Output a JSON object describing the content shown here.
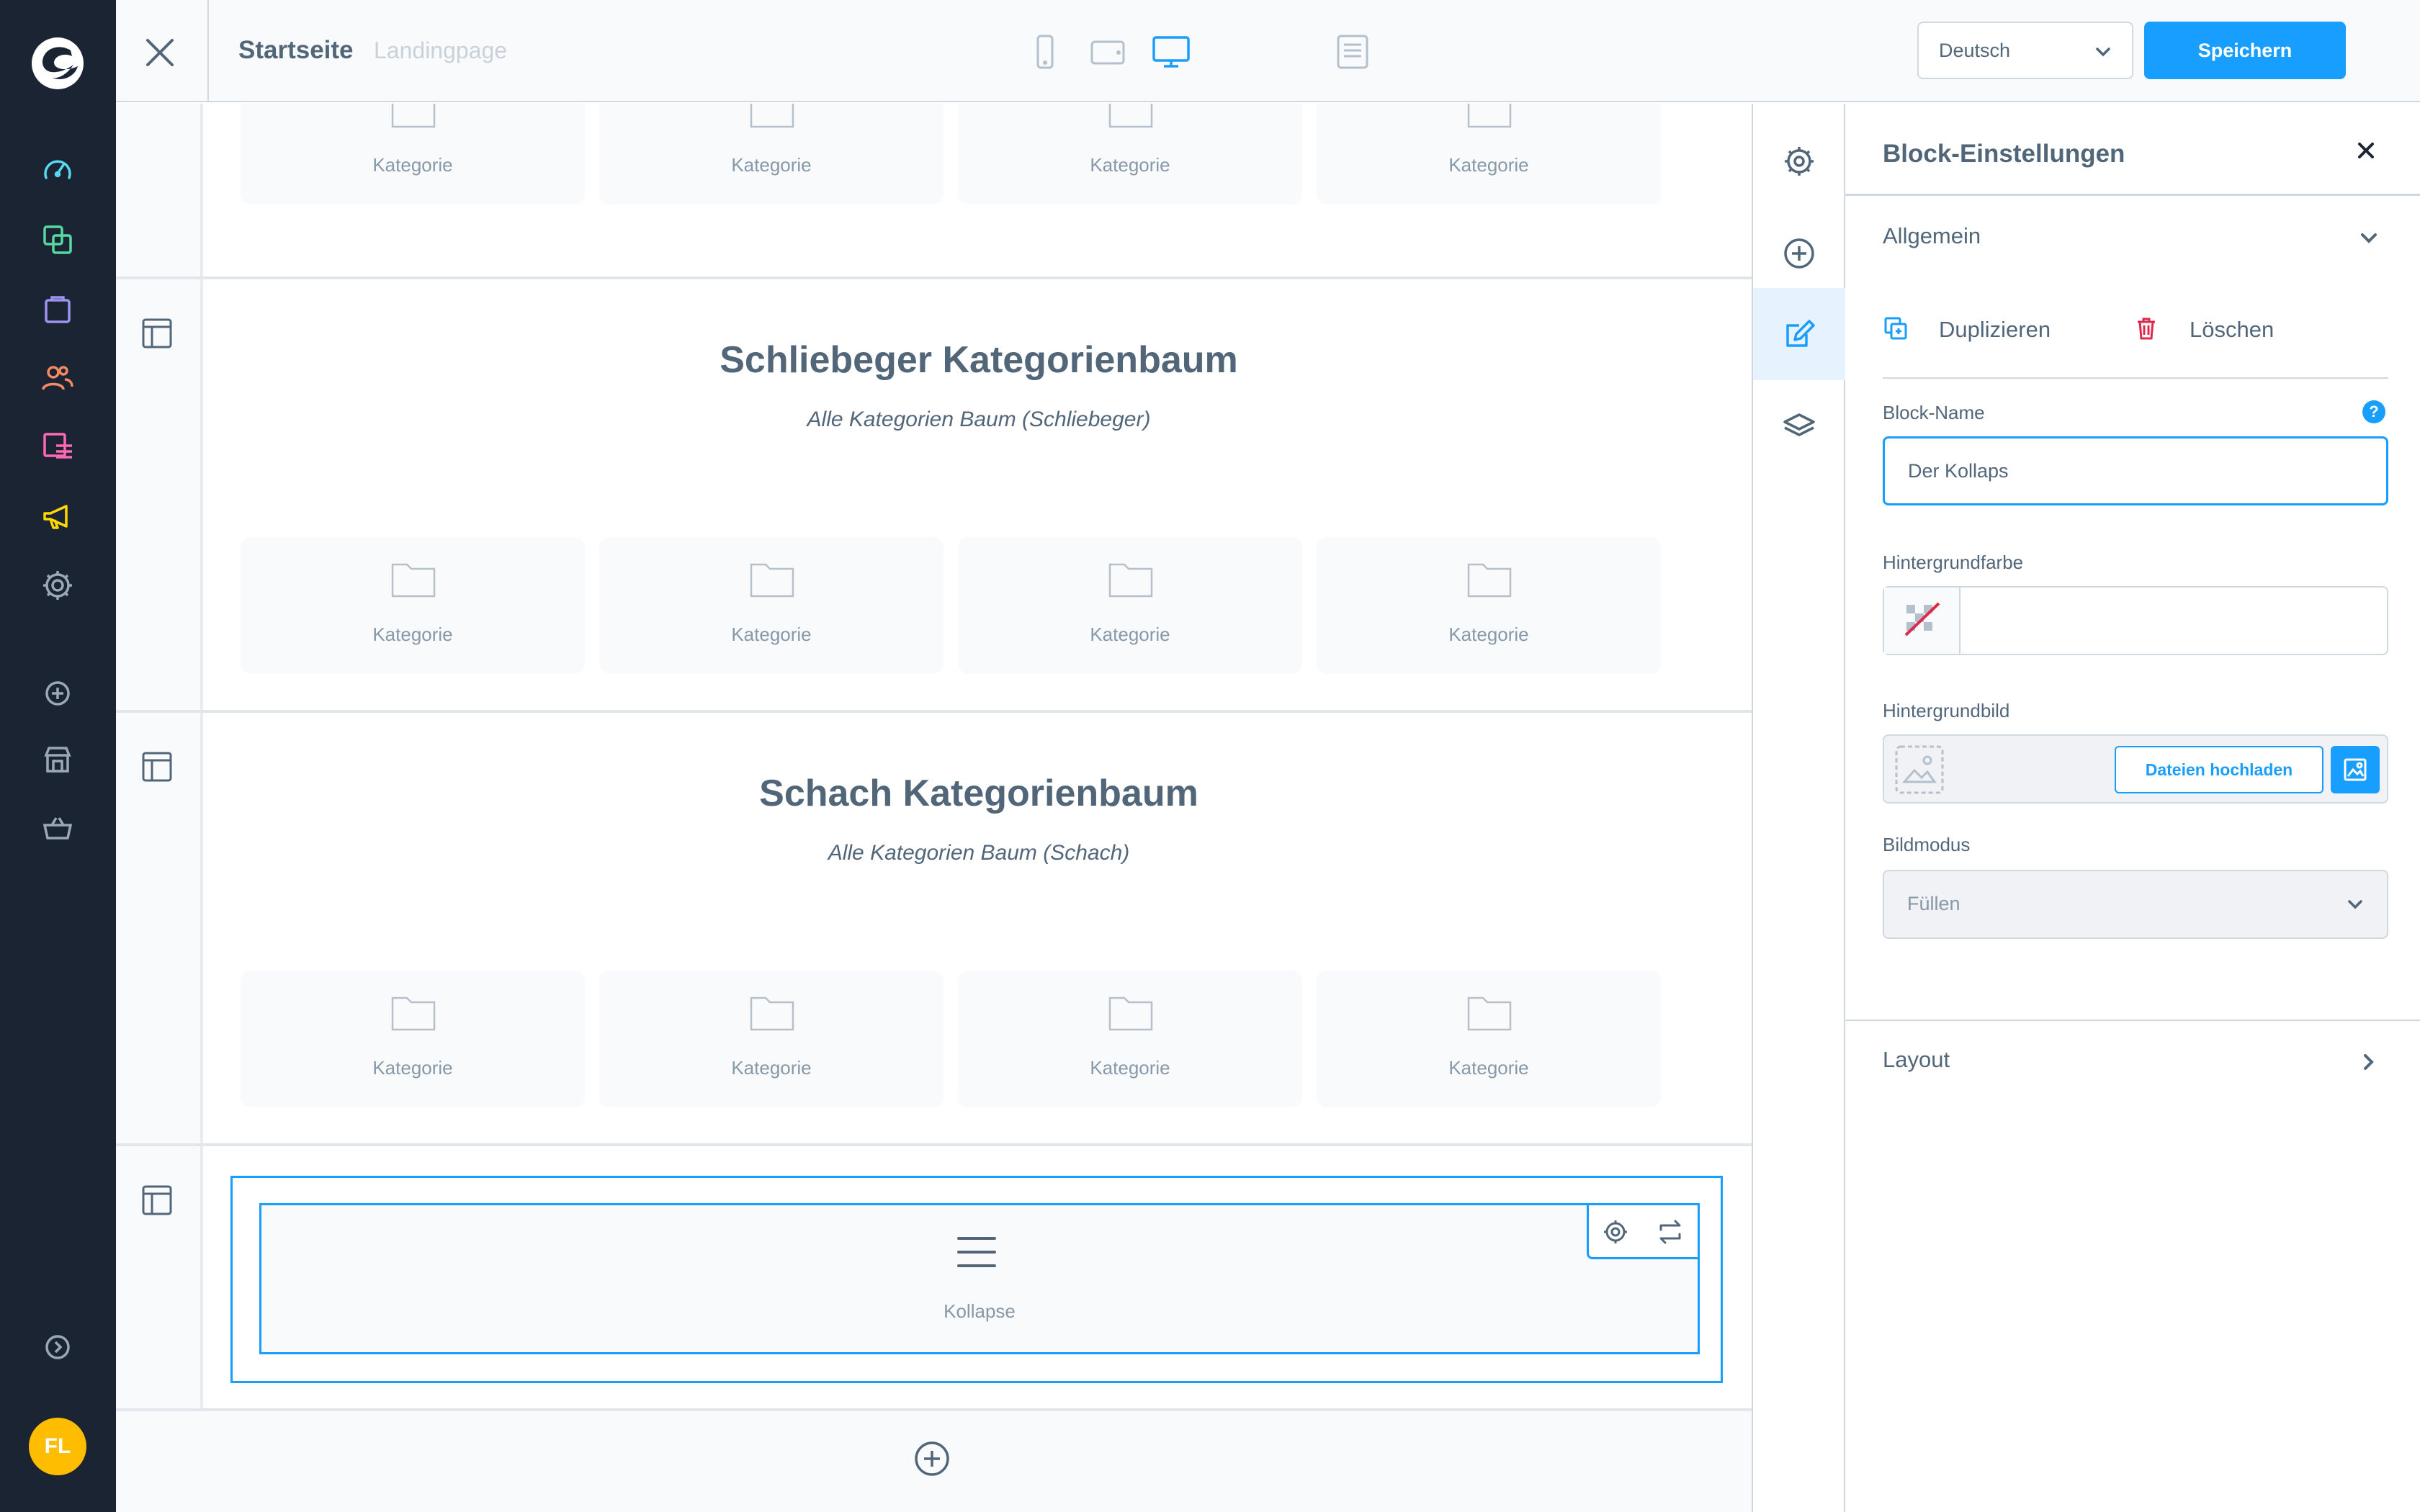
{
  "app": {
    "avatar_initials": "FL",
    "accent_color": "#189eff",
    "sidebar_bg": "#1b2433"
  },
  "sidebar": {
    "items": [
      {
        "name": "dashboard-icon",
        "color": "#57d9f0"
      },
      {
        "name": "catalogue-icon",
        "color": "#57d9a3"
      },
      {
        "name": "orders-icon",
        "color": "#a092f0"
      },
      {
        "name": "customers-icon",
        "color": "#f88962"
      },
      {
        "name": "content-icon",
        "color": "#ff68b4"
      },
      {
        "name": "marketing-icon",
        "color": "#ffd700"
      },
      {
        "name": "settings-icon",
        "color": "#9aa8b5"
      },
      {
        "name": "extensions-icon",
        "color": "#9aa8b5"
      },
      {
        "name": "store-icon",
        "color": "#9aa8b5"
      },
      {
        "name": "basket-icon",
        "color": "#9aa8b5"
      },
      {
        "name": "collapse-menu-icon",
        "color": "#9aa8b5"
      }
    ]
  },
  "topbar": {
    "title": "Startseite",
    "subtitle": "Landingpage",
    "devices": [
      "mobile-icon",
      "tablet-icon",
      "desktop-icon",
      "form-icon"
    ],
    "active_device": "desktop-icon",
    "language": "Deutsch",
    "save_label": "Speichern"
  },
  "canvas": {
    "top_cards": [
      "Kategorie",
      "Kategorie",
      "Kategorie",
      "Kategorie"
    ],
    "sections": [
      {
        "title": "Schliebeger Kategorienbaum",
        "subtitle": "Alle Kategorien Baum (Schliebeger)",
        "cards": [
          "Kategorie",
          "Kategorie",
          "Kategorie",
          "Kategorie"
        ]
      },
      {
        "title": "Schach Kategorienbaum",
        "subtitle": "Alle Kategorien Baum (Schach)",
        "cards": [
          "Kategorie",
          "Kategorie",
          "Kategorie",
          "Kategorie"
        ]
      }
    ],
    "selected_block_label": "Kollapse"
  },
  "panel": {
    "title": "Block-Einstellungen",
    "general_label": "Allgemein",
    "duplicate_label": "Duplizieren",
    "delete_label": "Löschen",
    "block_name_label": "Block-Name",
    "block_name_value": "Der Kollaps",
    "help_glyph": "?",
    "background_color_label": "Hintergrundfarbe",
    "background_image_label": "Hintergrundbild",
    "upload_label": "Dateien hochladen",
    "image_mode_label": "Bildmodus",
    "image_mode_value": "Füllen",
    "layout_label": "Layout"
  }
}
